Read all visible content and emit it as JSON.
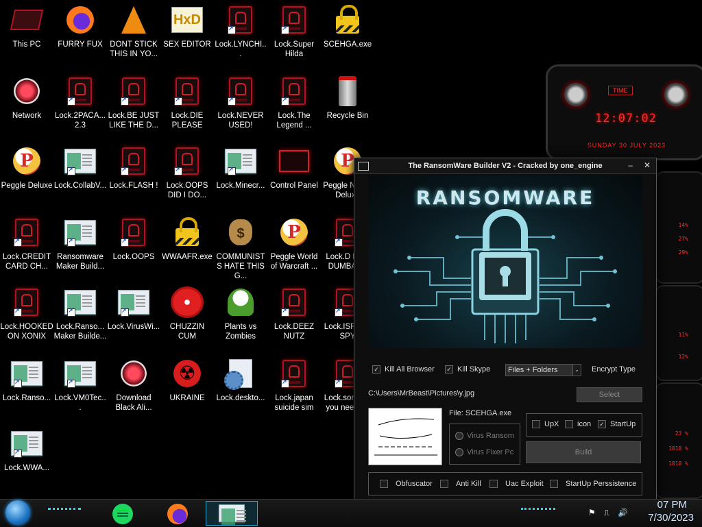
{
  "desktop": {
    "icons": [
      {
        "label": "This PC"
      },
      {
        "label": "FURRY FUX"
      },
      {
        "label": "DONT STICK THIS IN YO..."
      },
      {
        "label": "SEX EDITOR"
      },
      {
        "label": "Lock.LYNCHI..."
      },
      {
        "label": "Lock.Super Hilda"
      },
      {
        "label": "SCEHGA.exe"
      },
      {
        "label": "Network"
      },
      {
        "label": "Lock.2PACA... 2.3"
      },
      {
        "label": "Lock.BE JUST LIKE THE D..."
      },
      {
        "label": "Lock.DIE PLEASE"
      },
      {
        "label": "Lock.NEVER USED!"
      },
      {
        "label": "Lock.The Legend ..."
      },
      {
        "label": "Recycle Bin"
      },
      {
        "label": "Peggle Deluxe"
      },
      {
        "label": "Lock.CollabV..."
      },
      {
        "label": "Lock.FLASH !"
      },
      {
        "label": "Lock.OOPS DID I DO..."
      },
      {
        "label": "Lock.Minecr..."
      },
      {
        "label": "Control Panel"
      },
      {
        "label": "Peggle Nights Deluxe"
      },
      {
        "label": "Lock.CREDIT CARD CH..."
      },
      {
        "label": "Ransomware Maker Build..."
      },
      {
        "label": "Lock.OOPS"
      },
      {
        "label": "WWAAFR.exe"
      },
      {
        "label": "COMMUNISTS HATE THIS G..."
      },
      {
        "label": "Peggle World of Warcraft ..."
      },
      {
        "label": "Lock.D FOR DUMBASS"
      },
      {
        "label": "Lock.HOOKED ON XONIX"
      },
      {
        "label": "Lock.Ranso... Maker Builde..."
      },
      {
        "label": "Lock.VirusWi..."
      },
      {
        "label": "CHUZZIN CUM"
      },
      {
        "label": "Plants vs Zombies"
      },
      {
        "label": "Lock.DEEZ NUTZ"
      },
      {
        "label": "Lock.ISRAEL SPY"
      },
      {
        "label": "Lock.Ranso..."
      },
      {
        "label": "Lock.VM0Tec..."
      },
      {
        "label": "Download Black Ali..."
      },
      {
        "label": "UKRAINE"
      },
      {
        "label": "Lock.deskto..."
      },
      {
        "label": "Lock.japan suicide sim"
      },
      {
        "label": "Lock.some of you need t..."
      },
      {
        "label": "Lock.WWA..."
      }
    ]
  },
  "clock_widget": {
    "label": "TIME",
    "time": "12:07:02",
    "date": "SUNDAY 30 JULY 2023"
  },
  "side_stats": {
    "a": [
      "14%",
      "27%",
      "29%"
    ],
    "b": [
      "11%",
      "12%"
    ],
    "c": [
      "23 %",
      "1818 %",
      "1818 %"
    ]
  },
  "window": {
    "title": "The RansomWare Builder V2 - Cracked by one_engine",
    "banner_title": "RANSOMWARE",
    "kill_all_browser": "Kill All Browser",
    "kill_skype": "Kill Skype",
    "encrypt_combo": "Files + Folders",
    "encrypt_type_label": "Encrypt Type",
    "path": "C:\\Users\\MrBeast\\Pictures\\y.jpg",
    "select_button": "Select",
    "file_label": "File: SCEHGA.exe",
    "radio_virus_ransom": "Virus Ransom",
    "radio_virus_fixer": "Virus Fixer Pc",
    "upx": "UpX",
    "icon": "icon",
    "startup": "StartUp",
    "build_button": "Build",
    "obfuscator": "Obfuscator",
    "anti_kill": "Anti Kill",
    "uac_exploit": "Uac Exploit",
    "startup_persistence": "StartUp Perssistence"
  },
  "taskbar": {
    "time": "07 PM",
    "date": "7/30/2023"
  }
}
